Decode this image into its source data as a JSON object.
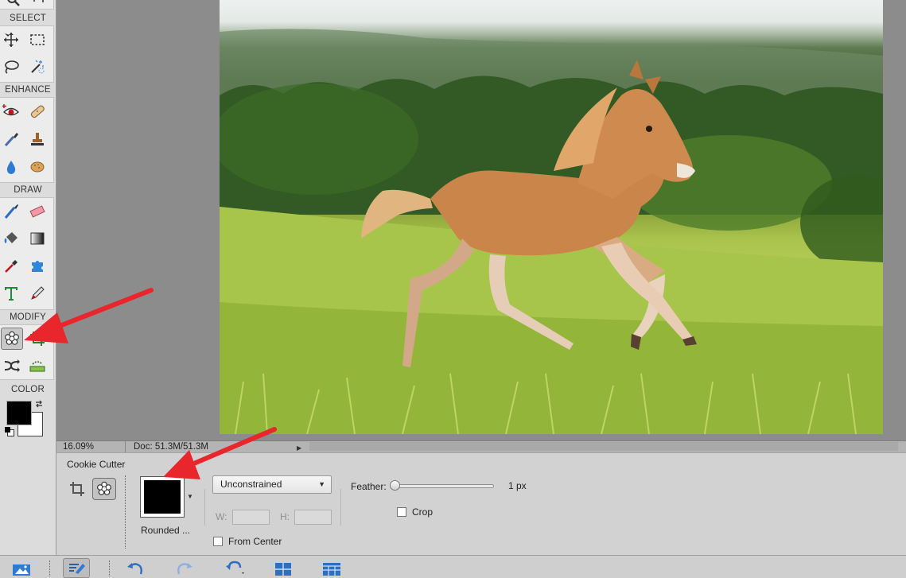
{
  "toolbox": {
    "sections": {
      "select": "SELECT",
      "enhance": "ENHANCE",
      "draw": "DRAW",
      "modify": "MODIFY",
      "color": "COLOR"
    },
    "selected_tool": "cookie-cutter-tool",
    "foreground_color": "#000000",
    "background_color": "#ffffff"
  },
  "status": {
    "zoom": "16.09%",
    "doc": "Doc: 51.3M/51.3M"
  },
  "options": {
    "tool_title": "Cookie Cutter",
    "shape_label": "Rounded ...",
    "shape_color": "#000000",
    "constraint": "Unconstrained",
    "w_label": "W:",
    "h_label": "H:",
    "feather_label": "Feather:",
    "feather_value": "1 px",
    "feather_fraction": 0.0,
    "crop_label": "Crop",
    "crop_checked": false,
    "from_center_label": "From Center",
    "from_center_checked": false
  },
  "annotation_color": "#e8262b"
}
